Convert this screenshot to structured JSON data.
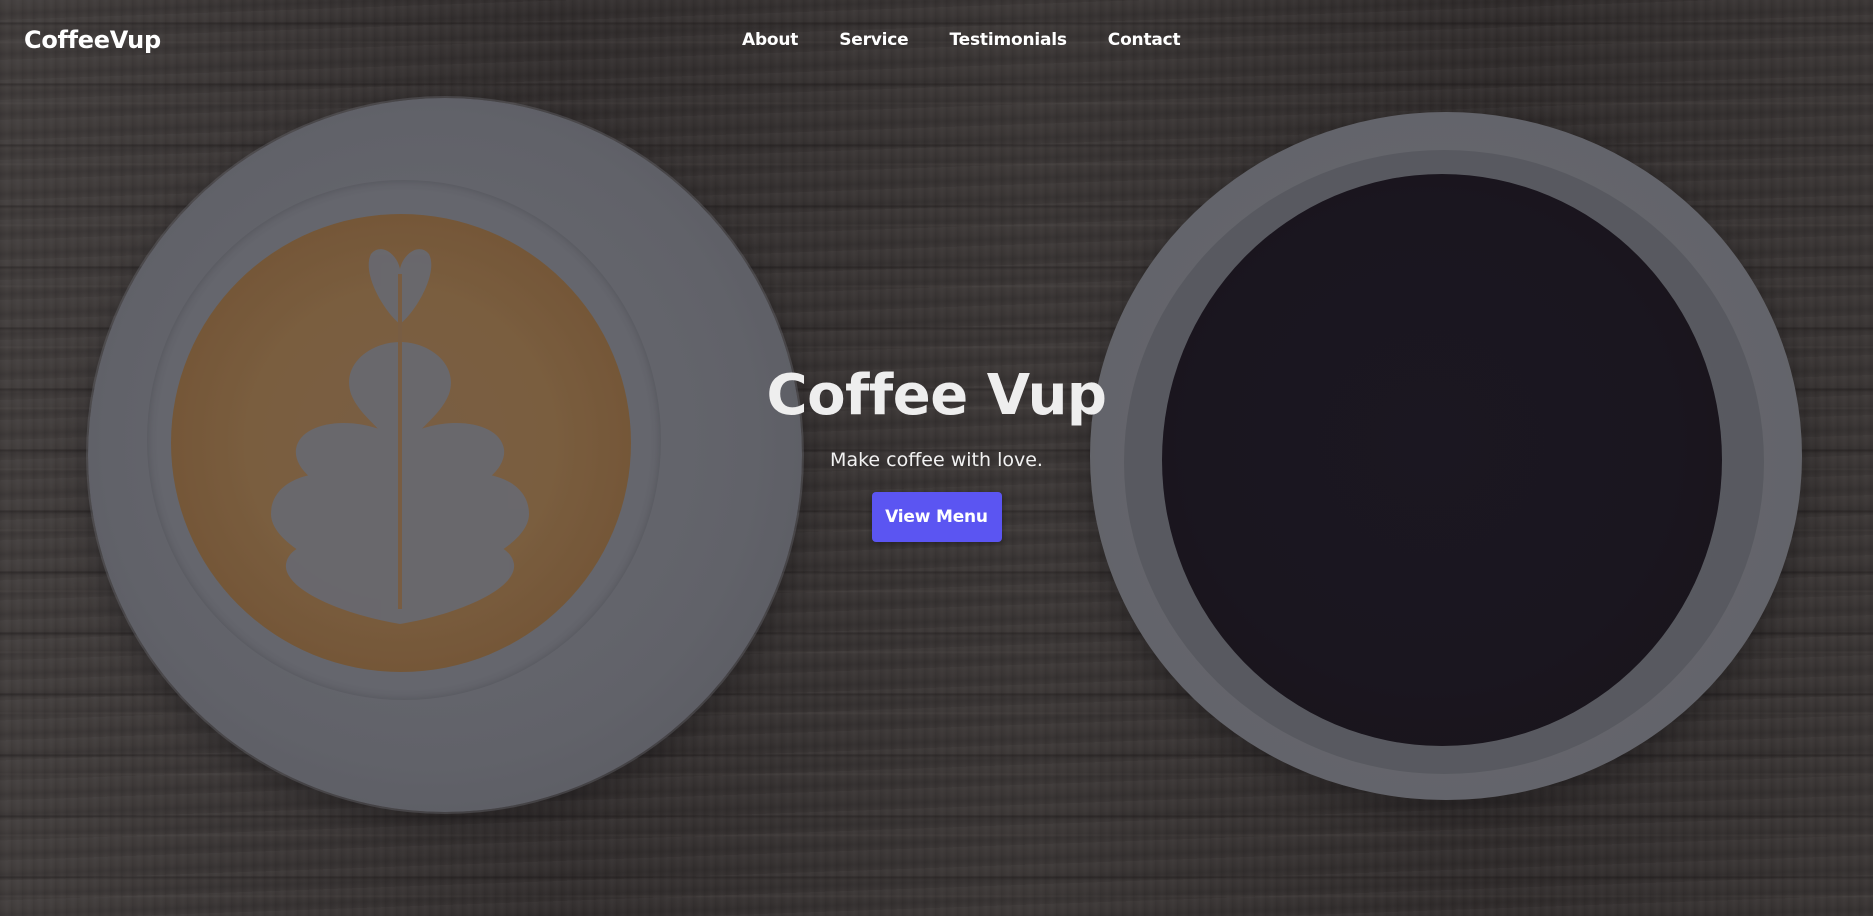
{
  "brand": {
    "name": "CoffeeVup"
  },
  "nav": {
    "items": [
      {
        "label": "About"
      },
      {
        "label": "Service"
      },
      {
        "label": "Testimonials"
      },
      {
        "label": "Contact"
      }
    ]
  },
  "hero": {
    "title": "Coffee Vup",
    "subtitle": "Make coffee with love.",
    "button_label": "View Menu"
  },
  "colors": {
    "accent": "#5b55f2",
    "text": "#ffffff",
    "overlay": "#19161e"
  },
  "images": {
    "background": "wooden-table-texture",
    "left_cup": "latte-art-cup-icon",
    "right_cup": "black-coffee-cup-icon"
  }
}
